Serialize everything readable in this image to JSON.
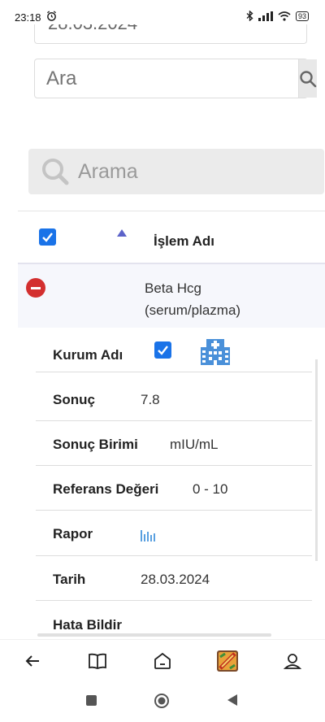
{
  "status_bar": {
    "time": "23:18",
    "battery": "93"
  },
  "date_field": {
    "value": "28.03.2024"
  },
  "search": {
    "placeholder": "Ara"
  },
  "filter": {
    "placeholder": "Arama"
  },
  "table": {
    "header": {
      "column_label": "İşlem Adı"
    },
    "row": {
      "name_line1": "Beta Hcg",
      "name_line2": "(serum/plazma)"
    },
    "details": {
      "kurum_label": "Kurum Adı",
      "sonuc_label": "Sonuç",
      "sonuc_value": "7.8",
      "birim_label": "Sonuç Birimi",
      "birim_value": "mIU/mL",
      "referans_label": "Referans Değeri",
      "referans_value": "0 - 10",
      "rapor_label": "Rapor",
      "tarih_label": "Tarih",
      "tarih_value": "28.03.2024",
      "hata_label": "Hata Bildir"
    }
  },
  "bottom_nav": [
    "back-icon",
    "book-icon",
    "home-icon",
    "app-icon",
    "profile-icon"
  ],
  "colors": {
    "checkbox": "#1a73e8",
    "minus": "#d32f2f",
    "sort": "#5c63c9",
    "hospital": "#4a90d9"
  }
}
